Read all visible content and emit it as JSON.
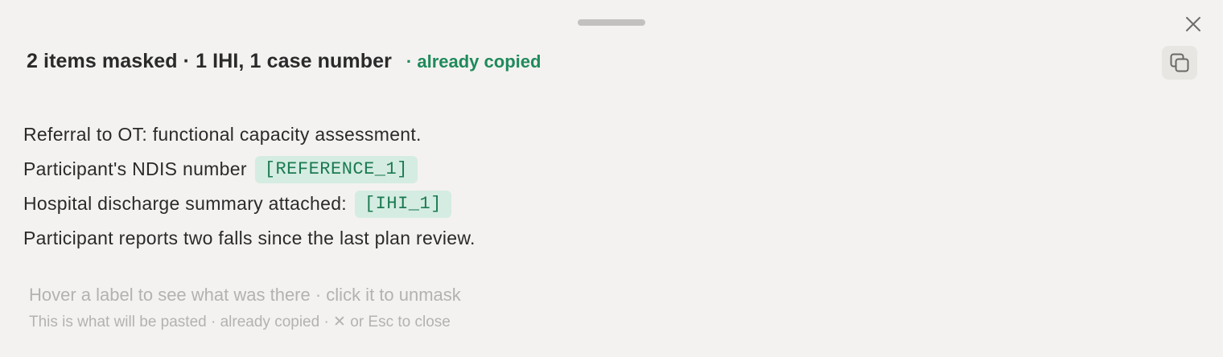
{
  "header": {
    "title": "2 items masked · 1 IHI, 1 case number",
    "status": "· already copied"
  },
  "body": {
    "line1": "Referral to OT: functional capacity assessment.",
    "line2_text": "Participant's NDIS number",
    "line2_label": "[REFERENCE_1]",
    "line3_text": "Hospital discharge summary attached:",
    "line3_label": "[IHI_1]",
    "line4": "Participant reports two falls since the last plan review."
  },
  "hints": {
    "primary": "Hover a label to see what was there · click it to unmask",
    "secondary": "This is what will be pasted · already copied · ✕ or Esc to close"
  },
  "icons": {
    "close": "close-icon",
    "copy": "copy-icon"
  },
  "colors": {
    "background": "#f4f2f0",
    "accent": "#1f8a5b",
    "label_bg": "#d5ece2",
    "label_text": "#1b7a52",
    "hint_text": "#b4b2b0"
  }
}
